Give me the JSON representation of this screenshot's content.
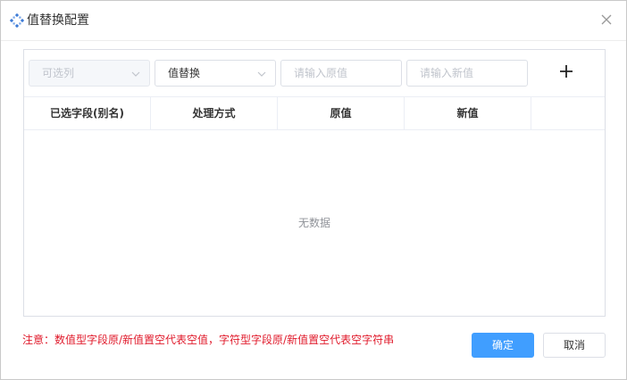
{
  "dialog": {
    "title": "值替换配置",
    "icons": {
      "title": "diamond-dots-icon",
      "close": "close-icon"
    }
  },
  "toolbar": {
    "column_select": {
      "placeholder": "可选列",
      "disabled": true
    },
    "mode_select": {
      "value": "值替换"
    },
    "old_value": {
      "placeholder": "请输入原值"
    },
    "new_value": {
      "placeholder": "请输入新值"
    },
    "add_icon": "plus-icon"
  },
  "table": {
    "columns": [
      "已选字段(别名)",
      "处理方式",
      "原值",
      "新值",
      ""
    ],
    "rows": [],
    "empty_text": "无数据"
  },
  "footer": {
    "note": "注意：数值型字段原/新值置空代表空值，字符型字段原/新值置空代表空字符串",
    "confirm_label": "确定",
    "cancel_label": "取消"
  },
  "colors": {
    "primary": "#409eff",
    "note": "#e0192a",
    "title_icon": "#3d7bd6"
  }
}
